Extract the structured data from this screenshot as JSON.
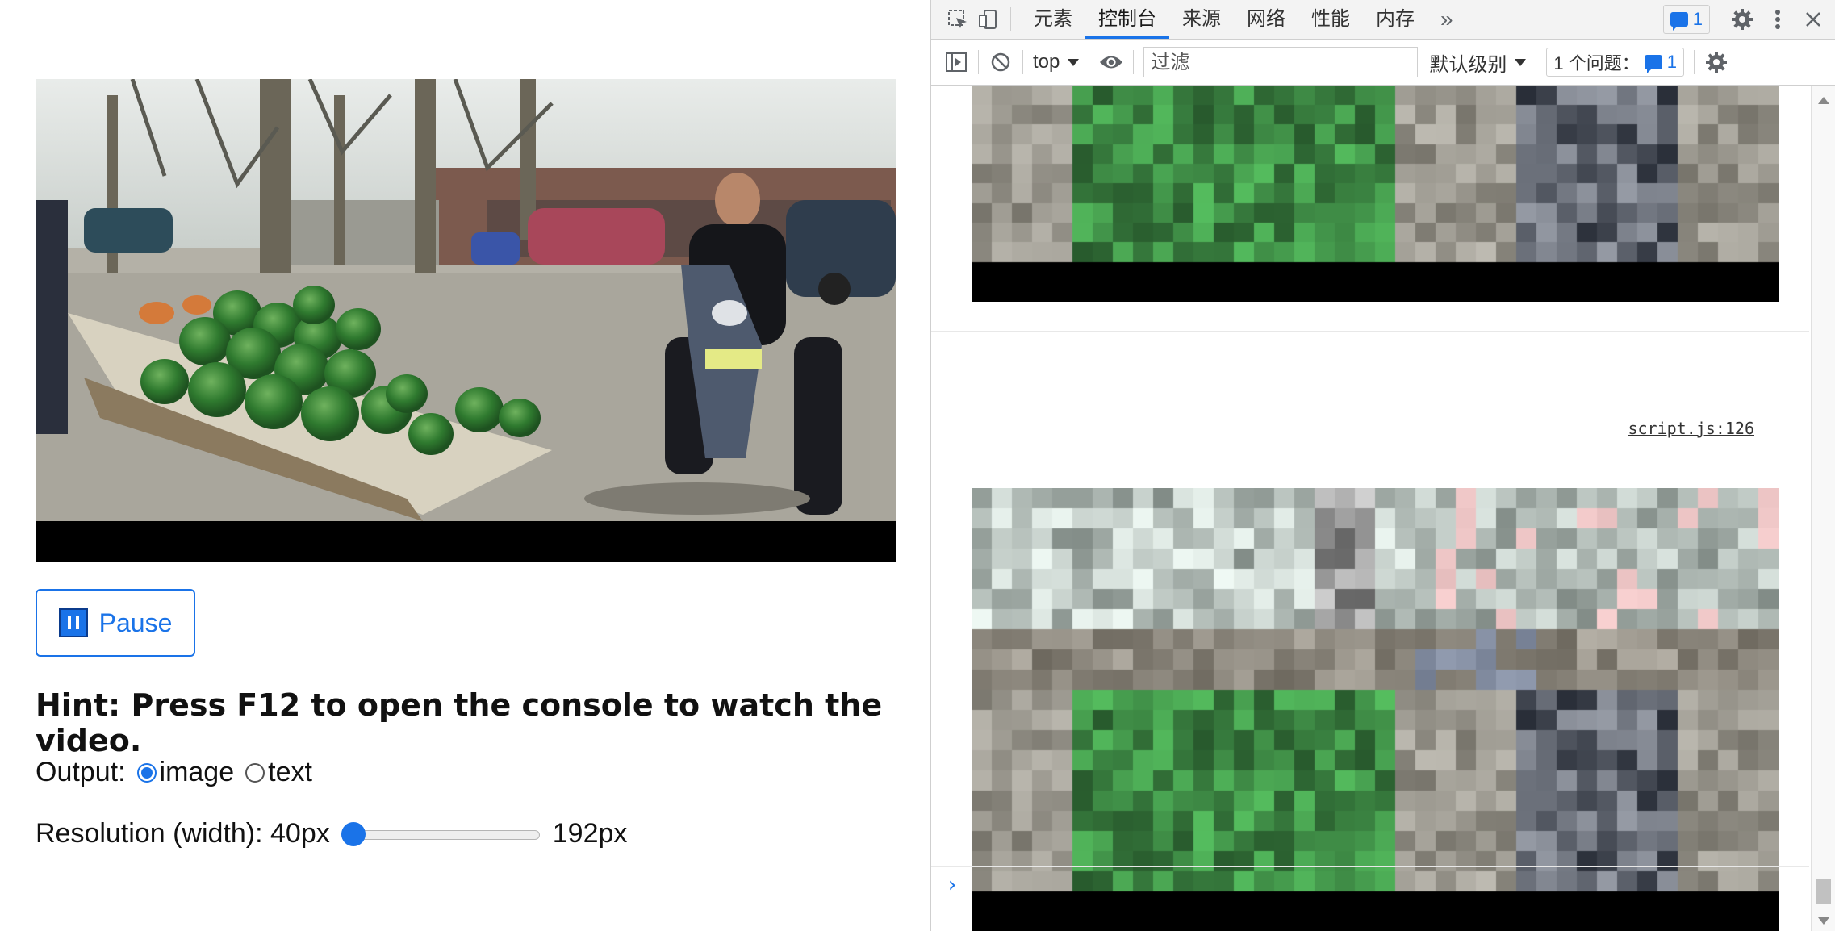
{
  "page": {
    "pause_label": "Pause",
    "hint": "Hint: Press F12 to open the console to watch the video.",
    "output_label": "Output:",
    "output_options": [
      "image",
      "text"
    ],
    "output_selected": "image",
    "resolution_label": "Resolution (width): 40px",
    "resolution_max": "192px",
    "resolution_level": 0
  },
  "devtools": {
    "tabs": [
      "元素",
      "控制台",
      "来源",
      "网络",
      "性能",
      "内存"
    ],
    "active_tab": "控制台",
    "more_tabs": "»",
    "issues_count": "1",
    "context": "top",
    "filter_placeholder": "过滤",
    "log_level": "默认级别",
    "issues_label": "1 个问题：",
    "issues_label_count": "1",
    "log_source": "script.js:126",
    "prompt": "›"
  },
  "colors": {
    "accent": "#1a73e8",
    "watermelon": "#3f8a3c",
    "road": "#a9a69c"
  },
  "icons": [
    "inspect-icon",
    "device-toolbar-icon",
    "more-tabs-icon",
    "issues-chat-icon",
    "settings-icon",
    "more-options-icon",
    "close-icon",
    "sidebar-toggle-icon",
    "clear-console-icon",
    "dropdown-icon",
    "live-expression-eye-icon",
    "pause-icon"
  ]
}
